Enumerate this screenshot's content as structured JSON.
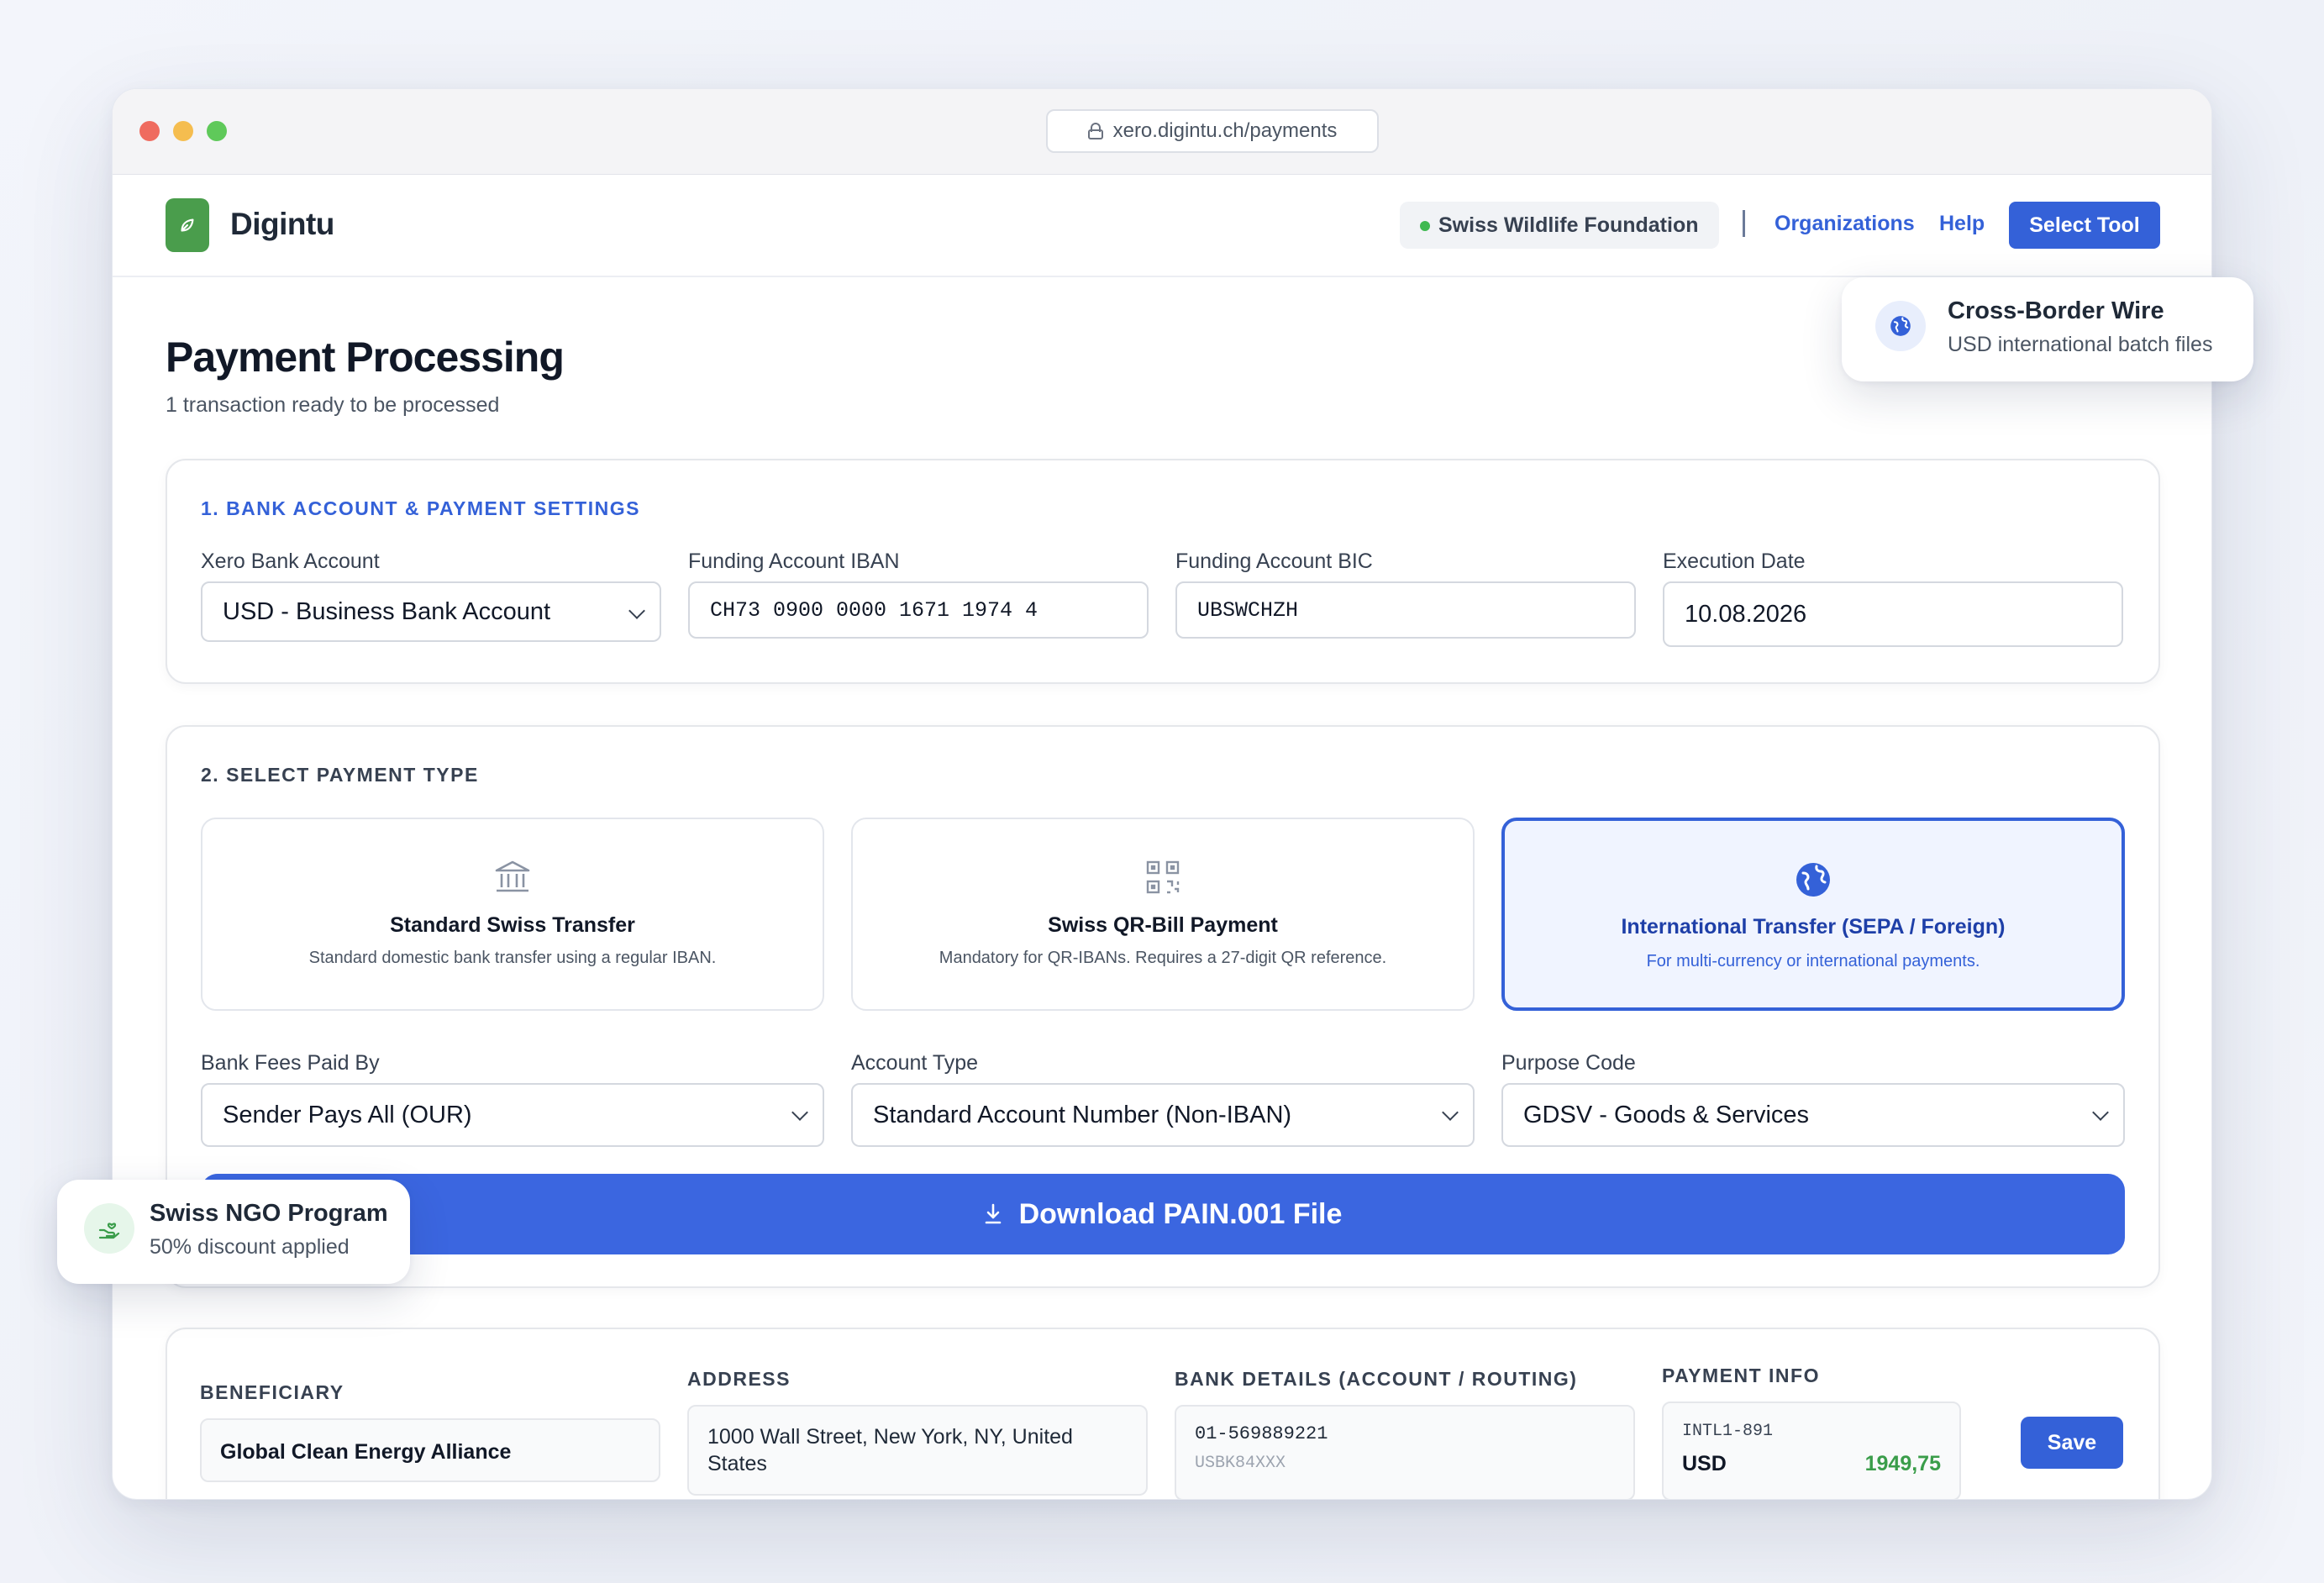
{
  "browser": {
    "url": "xero.digintu.ch/payments"
  },
  "header": {
    "brand": "Digintu",
    "organization": "Swiss Wildlife Foundation",
    "nav": {
      "organizations": "Organizations",
      "help": "Help"
    },
    "select_tool": "Select Tool"
  },
  "page": {
    "title": "Payment Processing",
    "subtitle": "1 transaction ready to be processed"
  },
  "bank_settings": {
    "section_title": "1. BANK ACCOUNT & PAYMENT SETTINGS",
    "xero_bank_account": {
      "label": "Xero Bank Account",
      "value": "USD - Business Bank Account"
    },
    "funding_iban": {
      "label": "Funding Account IBAN",
      "value": "CH73 0900 0000 1671 1974 4"
    },
    "funding_bic": {
      "label": "Funding Account BIC",
      "value": "UBSWCHZH"
    },
    "execution_date": {
      "label": "Execution Date",
      "value": "10.08.2026"
    }
  },
  "payment_type": {
    "section_title": "2. SELECT PAYMENT TYPE",
    "options": [
      {
        "title": "Standard Swiss Transfer",
        "desc": "Standard domestic bank transfer using a regular IBAN.",
        "icon": "bank-icon",
        "selected": false
      },
      {
        "title": "Swiss QR-Bill Payment",
        "desc": "Mandatory for QR-IBANs. Requires a 27-digit QR reference.",
        "icon": "qr-code-icon",
        "selected": false
      },
      {
        "title": "International Transfer (SEPA / Foreign)",
        "desc": "For multi-currency or international payments.",
        "icon": "globe-icon",
        "selected": true
      }
    ],
    "bank_fees": {
      "label": "Bank Fees Paid By",
      "value": "Sender Pays All (OUR)"
    },
    "account_type": {
      "label": "Account Type",
      "value": "Standard Account Number (Non-IBAN)"
    },
    "purpose_code": {
      "label": "Purpose Code",
      "value": "GDSV - Goods & Services"
    },
    "download_label": "Download PAIN.001 File"
  },
  "transaction": {
    "headers": {
      "beneficiary": "BENEFICIARY",
      "address": "ADDRESS",
      "bank_details": "BANK DETAILS (ACCOUNT / ROUTING)",
      "payment_info": "PAYMENT INFO"
    },
    "beneficiary": "Global Clean Energy Alliance",
    "address": "1000 Wall Street, New York, NY, United States",
    "account": "01-569889221",
    "routing": "USBK84XXX",
    "reference": "INTL1-891",
    "currency": "USD",
    "amount": "1949,75",
    "save": "Save"
  },
  "floating": {
    "wire": {
      "title": "Cross-Border Wire",
      "subtitle": "USD international batch files"
    },
    "ngo": {
      "title": "Swiss NGO Program",
      "subtitle": "50% discount applied"
    }
  },
  "colors": {
    "accent": "#3461d8",
    "download": "#3b66e0",
    "brand_green": "#4a9d4c",
    "amount_green": "#3a9d4a"
  }
}
